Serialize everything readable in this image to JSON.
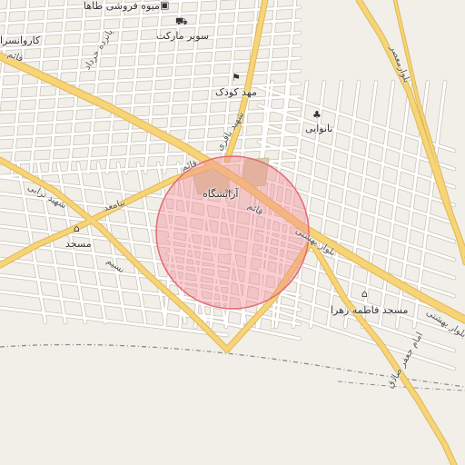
{
  "map": {
    "colors": {
      "land": "#f2efe9",
      "minor_road": "#ffffff",
      "minor_road_casing": "#c9c3b8",
      "major_road": "#f6d477",
      "major_road_casing": "#e0b750",
      "boundary": "#8c8c8c",
      "park": "#d6cfa8",
      "radius_fill": "#f28b93",
      "radius_stroke": "#e36b76"
    },
    "pois": [
      {
        "label": "میوه فروشی طاها",
        "icon": "shopping-basket-icon"
      },
      {
        "label": "سوپر مارکت",
        "icon": "shopping-cart-icon"
      },
      {
        "label": "کاروانسرا",
        "icon": ""
      },
      {
        "label": "مهد کودک",
        "icon": "school-icon"
      },
      {
        "label": "نانوایی",
        "icon": "bakery-icon"
      },
      {
        "label": "آرایشگاه",
        "icon": "scissors-icon"
      },
      {
        "label": "مسجد",
        "icon": "mosque-icon"
      },
      {
        "label": "مسجد فاطمه زهرا",
        "icon": "mosque-icon"
      }
    ],
    "streets": [
      "قائم",
      "قائم",
      "قائم",
      "شهید باقری",
      "بلوار بهشتی",
      "بلوار بهشتی",
      "بلوارمعصر",
      "پانزده خرداد",
      "شهید ترابی",
      "بیامعد",
      "نسیم",
      "امام جعفر صادق"
    ]
  }
}
